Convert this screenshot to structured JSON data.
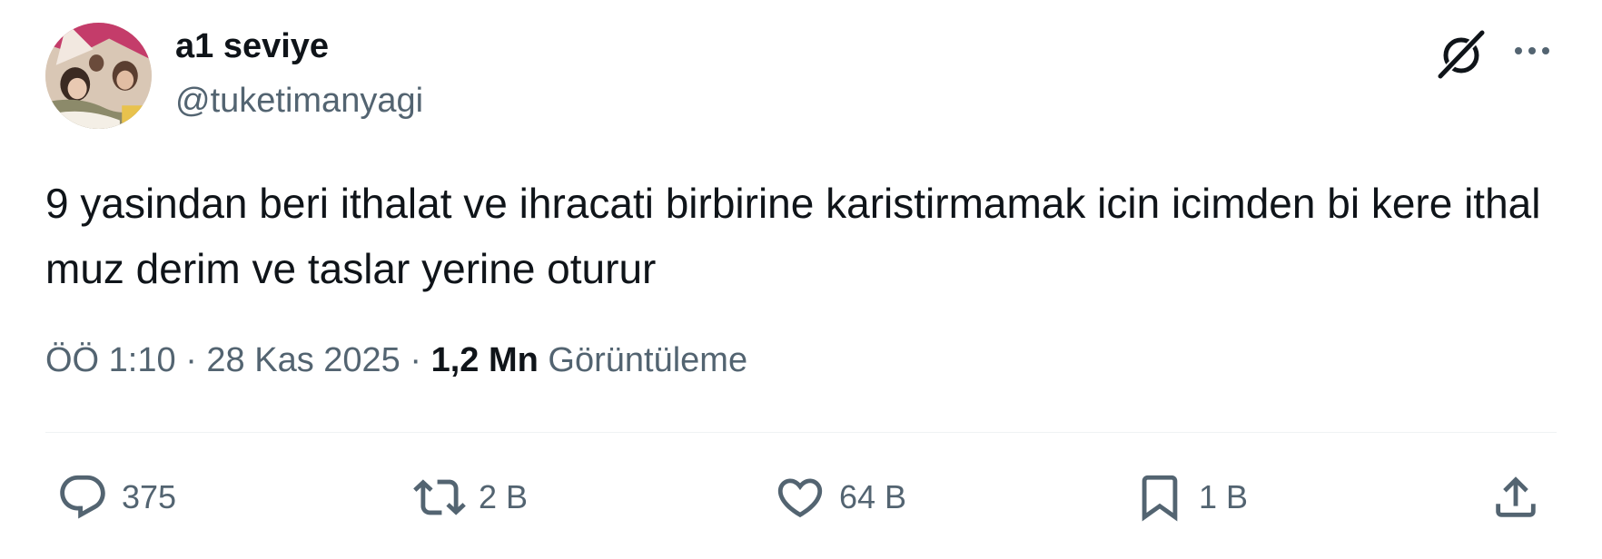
{
  "author": {
    "display_name": "a1 seviye",
    "handle": "@tuketimanyagi"
  },
  "tweet": {
    "text": "9 yasindan beri ithalat ve ihracati birbirine karistirmamak icin icimden bi kere ithal muz derim ve taslar yerine oturur"
  },
  "meta": {
    "time": "ÖÖ 1:10",
    "separator": "·",
    "date": "28 Kas 2025",
    "views_count": "1,2 Mn",
    "views_label": "Görüntüleme"
  },
  "actions": {
    "replies": "375",
    "reposts": "2 B",
    "likes": "64 B",
    "bookmarks": "1 B"
  },
  "icons": {
    "header": [
      "grok-icon",
      "more-icon"
    ],
    "actions": [
      "reply-icon",
      "repost-icon",
      "like-icon",
      "bookmark-icon",
      "share-icon"
    ]
  },
  "colors": {
    "text_primary": "#0f1419",
    "text_secondary": "#536471",
    "divider": "#eff3f4"
  }
}
